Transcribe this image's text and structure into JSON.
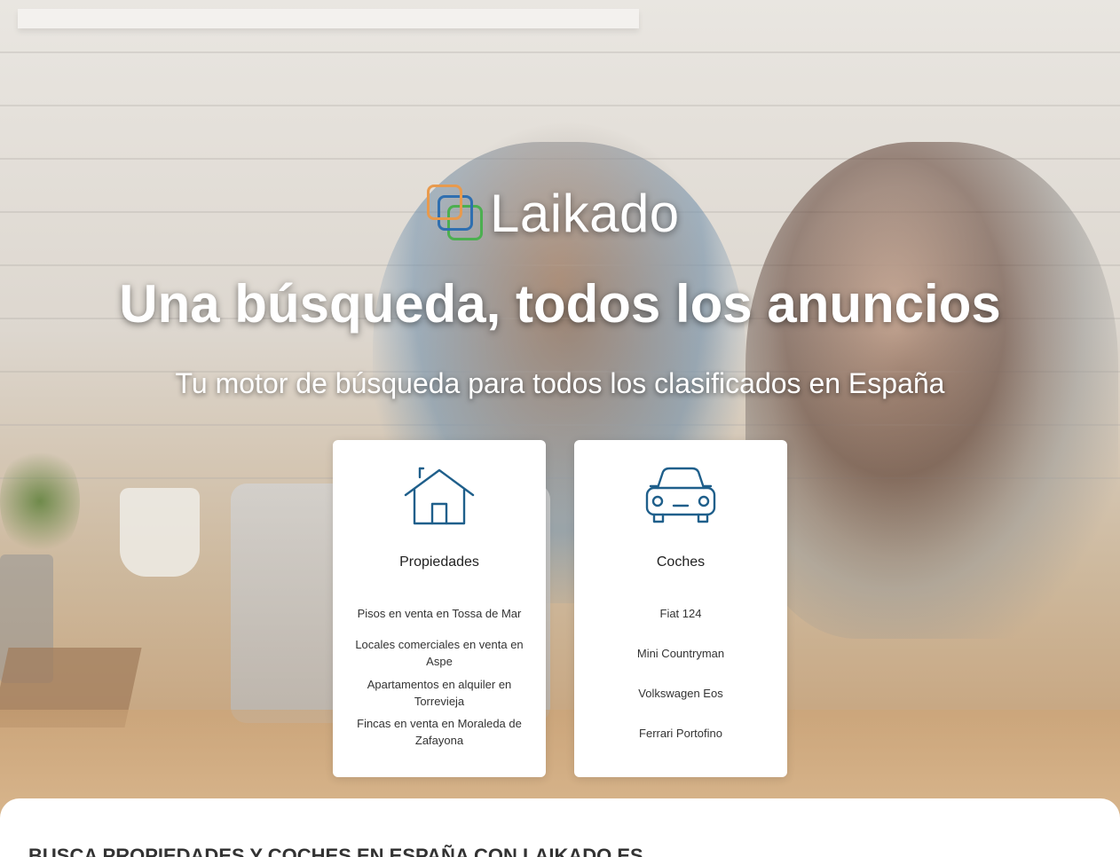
{
  "brand": {
    "name": "Laikado"
  },
  "hero": {
    "headline": "Una búsqueda, todos los anuncios",
    "subheadline": "Tu motor de búsqueda para todos los clasificados en España"
  },
  "cards": {
    "properties": {
      "icon": "house-icon",
      "title": "Propiedades",
      "links": [
        "Pisos en venta en Tossa de Mar",
        "Locales comerciales en venta en Aspe",
        "Apartamentos en alquiler en Torrevieja",
        "Fincas en venta en Moraleda de Zafayona"
      ]
    },
    "cars": {
      "icon": "car-icon",
      "title": "Coches",
      "links": [
        "Fiat 124",
        "Mini Countryman",
        "Volkswagen Eos",
        "Ferrari Portofino"
      ]
    }
  },
  "section": {
    "title": "BUSCA PROPIEDADES Y COCHES EN ESPAÑA CON LAIKADO.ES"
  },
  "colors": {
    "icon_stroke": "#1f5f8b",
    "logo_orange": "#e89a4d",
    "logo_blue": "#2f6fb0",
    "logo_green": "#4caf50"
  }
}
